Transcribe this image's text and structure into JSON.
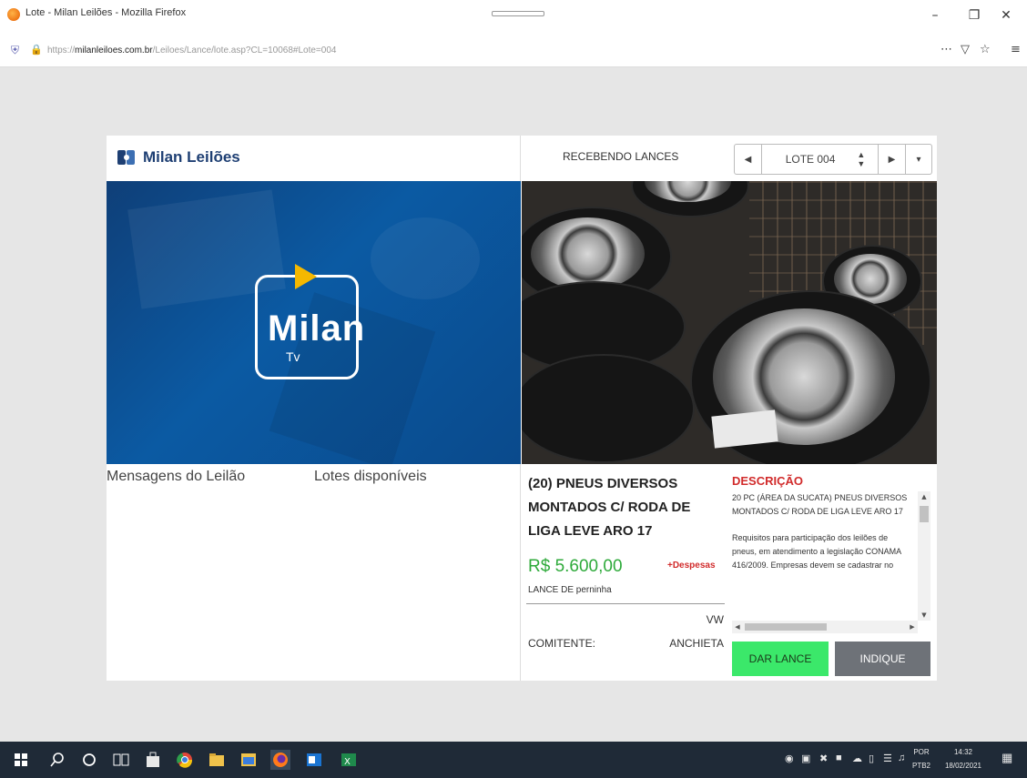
{
  "browser": {
    "window_title": "Lote - Milan Leilões - Mozilla Firefox",
    "url_prefix": "https://",
    "url_host": "milanleiloes.com.br",
    "url_path": "/Leiloes/Lance/lote.asp?CL=10068#Lote=004"
  },
  "brand": {
    "name": "Milan Leilões",
    "tv_title": "Milan",
    "tv_sub": "Tv"
  },
  "tabs": {
    "messages": "Mensagens do Leilão",
    "lots": "Lotes disponíveis"
  },
  "auction": {
    "status": "RECEBENDO LANCES",
    "lot_label": "LOTE 004"
  },
  "lot": {
    "title": "(20) PNEUS DIVERSOS MONTADOS C/ RODA DE LIGA LEVE ARO 17",
    "price": "R$ 5.600,00",
    "expenses": "+Despesas",
    "bid_by": "LANCE DE perninha",
    "brand": "VW",
    "consignor_label": "COMITENTE:",
    "consignor_value": "ANCHIETA"
  },
  "description": {
    "heading": "DESCRIÇÃO",
    "paragraph1": "20 PC (ÁREA DA SUCATA) PNEUS DIVERSOS MONTADOS C/ RODA DE LIGA LEVE ARO 17",
    "paragraph2": "Requisitos para participação dos leilões de pneus, em atendimento a legislação CONAMA 416/2009. Empresas devem se cadastrar no"
  },
  "buttons": {
    "bid": "DAR LANCE",
    "indicate": "INDIQUE"
  },
  "taskbar": {
    "lang_line1": "POR",
    "lang_line2": "PTB2",
    "time": "14:32",
    "date": "18/02/2021"
  },
  "colors": {
    "brand_blue": "#1e3f73",
    "price_green": "#2eaa3a",
    "accent_red": "#d12b2b",
    "bid_button": "#3be86a",
    "indicate_button": "#6e7278"
  }
}
